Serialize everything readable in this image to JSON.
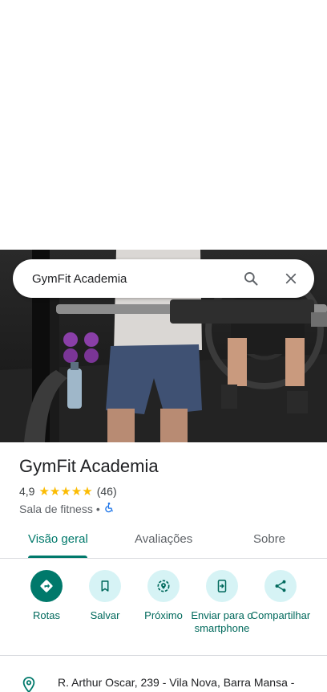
{
  "search": {
    "query": "GymFit Academia"
  },
  "place": {
    "name": "GymFit Academia",
    "rating": "4,9",
    "stars": "★★★★★",
    "review_count": "(46)",
    "category": "Sala de fitness",
    "separator": "•",
    "accessibility_icon": "wheelchair-icon"
  },
  "tabs": [
    {
      "label": "Visão geral",
      "active": true
    },
    {
      "label": "Avaliações",
      "active": false
    },
    {
      "label": "Sobre",
      "active": false
    }
  ],
  "actions": [
    {
      "label": "Rotas",
      "icon": "directions-icon"
    },
    {
      "label": "Salvar",
      "icon": "bookmark-icon"
    },
    {
      "label": "Próximo",
      "icon": "nearby-icon"
    },
    {
      "label": "Enviar para o smartphone",
      "icon": "send-to-phone-icon"
    },
    {
      "label": "Compartilhar",
      "icon": "share-icon"
    }
  ],
  "address": {
    "text": "R. Arthur Oscar, 239 - Vila Nova, Barra Mansa -",
    "icon": "location-pin-icon"
  },
  "colors": {
    "accent": "#00796b",
    "action_bg": "#d6f3f5",
    "star": "#fbbc04"
  }
}
